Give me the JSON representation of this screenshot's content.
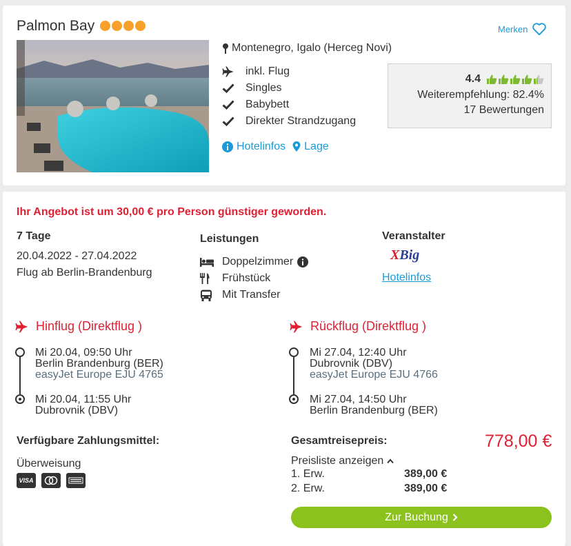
{
  "hotel": {
    "name": "Palmon Bay",
    "star_count": 4,
    "star_color": "#f7a12b",
    "merken_label": "Merken",
    "location": "Montenegro, Igalo (Herceg Novi)",
    "features": [
      {
        "icon": "plane-icon",
        "label": "inkl. Flug"
      },
      {
        "icon": "check-icon",
        "label": "Singles"
      },
      {
        "icon": "check-icon",
        "label": "Babybett"
      },
      {
        "icon": "check-icon",
        "label": "Direkter Strandzugang"
      }
    ],
    "links": {
      "hotelinfos": "Hotelinfos",
      "lage": "Lage"
    },
    "rating": {
      "score": "4.4",
      "thumbs_filled": 4.4,
      "recommendation": "Weiterempfehlung: 82.4%",
      "reviews": "17 Bewertungen"
    }
  },
  "offer": {
    "promo": "Ihr Angebot ist um 30,00 € pro Person günstiger geworden.",
    "duration": "7 Tage",
    "dates": "20.04.2022 - 27.04.2022",
    "departure": "Flug ab Berlin-Brandenburg",
    "leistungen_title": "Leistungen",
    "leistungen": [
      {
        "icon": "bed-icon",
        "label": "Doppelzimmer"
      },
      {
        "icon": "cutlery-icon",
        "label": "Frühstück"
      },
      {
        "icon": "bus-icon",
        "label": "Mit Transfer"
      }
    ],
    "veranstalter_title": "Veranstalter",
    "veranstalter_logo": {
      "x": "X",
      "rest": "Big"
    },
    "veranstalter_link": "Hotelinfos"
  },
  "flights": {
    "outbound": {
      "title": "Hinflug (Direktflug )",
      "dep_time": "Mi 20.04, 09:50 Uhr",
      "dep_airport": "Berlin Brandenburg (BER)",
      "airline": "easyJet Europe EJU 4765",
      "arr_time": "Mi 20.04, 11:55 Uhr",
      "arr_airport": "Dubrovnik (DBV)"
    },
    "return": {
      "title": "Rückflug (Direktflug )",
      "dep_time": "Mi 27.04, 12:40 Uhr",
      "dep_airport": "Dubrovnik (DBV)",
      "airline": "easyJet Europe EJU 4766",
      "arr_time": "Mi 27.04, 14:50 Uhr",
      "arr_airport": "Berlin Brandenburg (BER)"
    }
  },
  "payment": {
    "title": "Verfügbare Zahlungsmittel:",
    "method": "Überweisung",
    "cards": [
      "VISA",
      "Mastercard",
      "American Express"
    ]
  },
  "price": {
    "title": "Gesamtreisepreis:",
    "total": "778,00 €",
    "pricelist_toggle": "Preisliste anzeigen",
    "rows": [
      {
        "label": "1. Erw.",
        "value": "389,00 €"
      },
      {
        "label": "2. Erw.",
        "value": "389,00 €"
      }
    ],
    "book_button": "Zur Buchung"
  },
  "colors": {
    "accent_red": "#e02133",
    "link_blue": "#1a9bd7",
    "button_green": "#8cc21e",
    "thumb_green": "#7dba2f"
  }
}
